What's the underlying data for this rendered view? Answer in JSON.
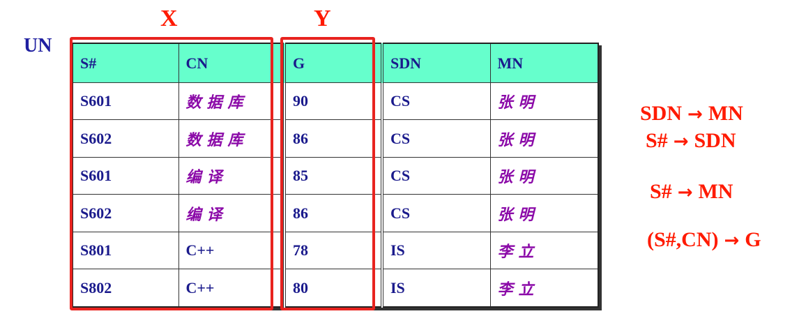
{
  "relation_name": "UN",
  "markers": {
    "x": "X",
    "y": "Y"
  },
  "table": {
    "headers": [
      "S#",
      "CN",
      "G",
      "SDN",
      "MN"
    ],
    "rows": [
      [
        "S601",
        "数据库",
        "90",
        "CS",
        "张明"
      ],
      [
        "S602",
        "数据库",
        "86",
        "CS",
        "张明"
      ],
      [
        "S601",
        "编译",
        "85",
        "CS",
        "张明"
      ],
      [
        "S602",
        "编译",
        "86",
        "CS",
        "张明"
      ],
      [
        "S801",
        "C++",
        "78",
        "IS",
        "李立"
      ],
      [
        "S802",
        "C++",
        "80",
        "IS",
        "李立"
      ]
    ]
  },
  "dependencies": [
    {
      "left": "SDN",
      "arrow": "→",
      "right": "MN"
    },
    {
      "left": "S#",
      "arrow": "→",
      "right": "SDN"
    },
    {
      "left": "S#",
      "arrow": "→",
      "right": "MN"
    },
    {
      "left": "(S#,CN)",
      "arrow": "→",
      "right": "G"
    }
  ],
  "colors": {
    "header_bg": "#66ffcc",
    "text": "#1a1a8c",
    "cjk_text": "#8b0aa8",
    "highlight": "#ff1a00"
  }
}
